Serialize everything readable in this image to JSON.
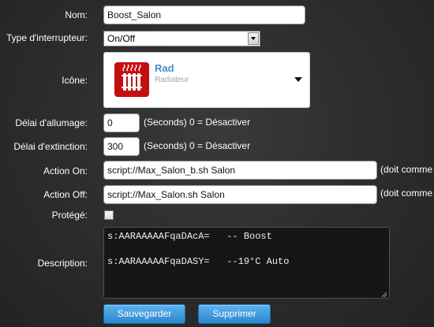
{
  "form": {
    "name": {
      "label": "Nom:",
      "value": "Boost_Salon"
    },
    "switch_type": {
      "label": "Type d'interrupteur:",
      "selected": "On/Off"
    },
    "icon": {
      "label": "Icône:",
      "title": "Rad",
      "subtitle": "Radiateur",
      "image": "radiator-icon",
      "color": "#c40f12"
    },
    "on_delay": {
      "label": "Délai d'allumage:",
      "value": "0",
      "hint": "(Seconds) 0 = Désactiver"
    },
    "off_delay": {
      "label": "Délai d'extinction:",
      "value": "300",
      "hint": "(Seconds) 0 = Désactiver"
    },
    "action_on": {
      "label": "Action On:",
      "value": "script://Max_Salon_b.sh Salon",
      "hint": "(doit comme"
    },
    "action_off": {
      "label": "Action Off:",
      "value": "script://Max_Salon.sh Salon",
      "hint": "(doit comme"
    },
    "protected": {
      "label": "Protégé:",
      "checked": false
    },
    "description": {
      "label": "Description:",
      "lines": [
        "s:AARAAAAAFqaDAcA=   -- Boost",
        "",
        "s:AARAAAAAFqaDASY=   --19°C Auto"
      ]
    }
  },
  "buttons": {
    "save": "Sauvegarder",
    "delete": "Supprimer"
  },
  "colors": {
    "accent": "#3d8fcf",
    "button": "#3a96dc"
  }
}
